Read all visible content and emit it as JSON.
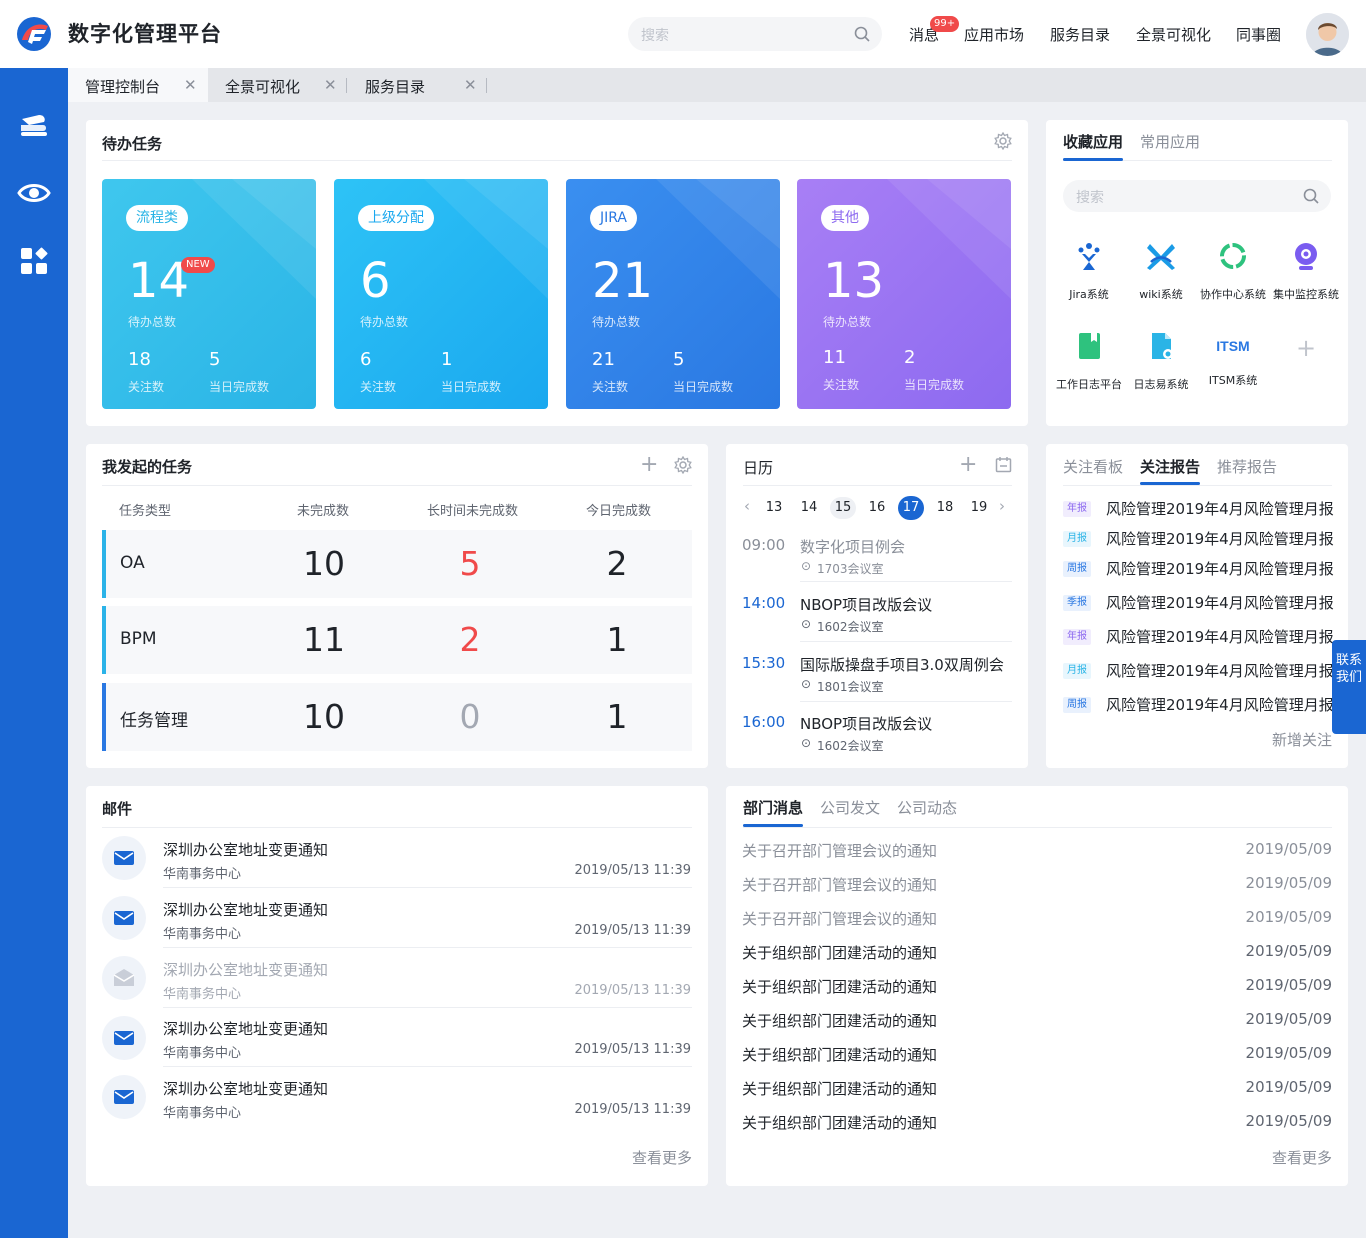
{
  "header": {
    "brand": "数字化管理平台",
    "search_placeholder": "搜索",
    "nav": [
      "消息",
      "应用市场",
      "服务目录",
      "全景可视化",
      "同事圈"
    ],
    "msg_badge": "99+"
  },
  "tabs": [
    "管理控制台",
    "全景可视化",
    "服务目录"
  ],
  "tasks": {
    "title": "待办任务",
    "cards": [
      {
        "tag": "流程类",
        "total": "14",
        "total_label": "待办总数",
        "follow": "18",
        "follow_label": "关注数",
        "done": "5",
        "done_label": "当日完成数",
        "new": "NEW"
      },
      {
        "tag": "上级分配",
        "total": "6",
        "total_label": "待办总数",
        "follow": "6",
        "follow_label": "关注数",
        "done": "1",
        "done_label": "当日完成数"
      },
      {
        "tag": "JIRA",
        "total": "21",
        "total_label": "待办总数",
        "follow": "21",
        "follow_label": "关注数",
        "done": "5",
        "done_label": "当日完成数"
      },
      {
        "tag": "其他",
        "total": "13",
        "total_label": "待办总数",
        "follow": "11",
        "follow_label": "关注数",
        "done": "2",
        "done_label": "当日完成数"
      }
    ]
  },
  "favorites": {
    "tabs": [
      "收藏应用",
      "常用应用"
    ],
    "search_placeholder": "搜索",
    "apps": [
      "Jira系统",
      "wiki系统",
      "协作中心系统",
      "集中监控系统",
      "工作日志平台",
      "日志易系统",
      "ITSM系统"
    ],
    "itsm_logo": "ITSM"
  },
  "mytasks": {
    "title": "我发起的任务",
    "columns": [
      "任务类型",
      "未完成数",
      "长时间未完成数",
      "今日完成数"
    ],
    "rows": [
      {
        "type": "OA",
        "undone": "10",
        "long": "5",
        "today": "2"
      },
      {
        "type": "BPM",
        "undone": "11",
        "long": "2",
        "today": "1"
      },
      {
        "type": "任务管理",
        "undone": "10",
        "long": "0",
        "today": "1"
      }
    ]
  },
  "calendar": {
    "title": "日历",
    "days": [
      "13",
      "14",
      "15",
      "16",
      "17",
      "18",
      "19"
    ],
    "events": [
      {
        "time": "09:00",
        "title": "数字化项目例会",
        "loc": "1703会议室"
      },
      {
        "time": "14:00",
        "title": "NBOP项目改版会议",
        "loc": "1602会议室"
      },
      {
        "time": "15:30",
        "title": "国际版操盘手项目3.0双周例会",
        "loc": "1801会议室"
      },
      {
        "time": "16:00",
        "title": "NBOP项目改版会议",
        "loc": "1602会议室"
      }
    ]
  },
  "reports": {
    "tabs": [
      "关注看板",
      "关注报告",
      "推荐报告"
    ],
    "items": [
      {
        "badge": "年报",
        "title": "风险管理2019年4月风险管理月报"
      },
      {
        "badge": "月报",
        "title": "风险管理2019年4月风险管理月报"
      },
      {
        "badge": "周报",
        "title": "风险管理2019年4月风险管理月报"
      },
      {
        "badge": "季报",
        "title": "风险管理2019年4月风险管理月报"
      },
      {
        "badge": "年报",
        "title": "风险管理2019年4月风险管理月报"
      },
      {
        "badge": "月报",
        "title": "风险管理2019年4月风险管理月报"
      },
      {
        "badge": "周报",
        "title": "风险管理2019年4月风险管理月报"
      }
    ],
    "add_label": "新增关注"
  },
  "contact": "联系我们",
  "mail": {
    "title": "邮件",
    "items": [
      {
        "title": "深圳办公室地址变更通知",
        "from": "华南事务中心",
        "time": "2019/05/13 11:39"
      },
      {
        "title": "深圳办公室地址变更通知",
        "from": "华南事务中心",
        "time": "2019/05/13 11:39"
      },
      {
        "title": "深圳办公室地址变更通知",
        "from": "华南事务中心",
        "time": "2019/05/13 11:39"
      },
      {
        "title": "深圳办公室地址变更通知",
        "from": "华南事务中心",
        "time": "2019/05/13 11:39"
      },
      {
        "title": "深圳办公室地址变更通知",
        "from": "华南事务中心",
        "time": "2019/05/13 11:39"
      }
    ],
    "more": "查看更多"
  },
  "news": {
    "tabs": [
      "部门消息",
      "公司发文",
      "公司动态"
    ],
    "items": [
      {
        "title": "关于召开部门管理会议的通知",
        "date": "2019/05/09"
      },
      {
        "title": "关于召开部门管理会议的通知",
        "date": "2019/05/09"
      },
      {
        "title": "关于召开部门管理会议的通知",
        "date": "2019/05/09"
      },
      {
        "title": "关于组织部门团建活动的通知",
        "date": "2019/05/09"
      },
      {
        "title": "关于组织部门团建活动的通知",
        "date": "2019/05/09"
      },
      {
        "title": "关于组织部门团建活动的通知",
        "date": "2019/05/09"
      },
      {
        "title": "关于组织部门团建活动的通知",
        "date": "2019/05/09"
      },
      {
        "title": "关于组织部门团建活动的通知",
        "date": "2019/05/09"
      },
      {
        "title": "关于组织部门团建活动的通知",
        "date": "2019/05/09"
      }
    ],
    "more": "查看更多"
  }
}
